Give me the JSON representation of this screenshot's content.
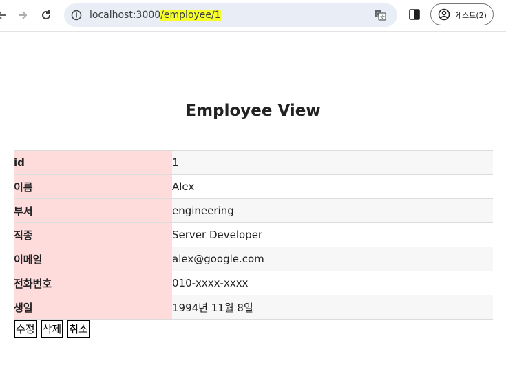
{
  "browser": {
    "url_host": "localhost:3000",
    "url_path": "/employee/1",
    "profile_label": "게스트(2)",
    "highlight_color": "#f6ff2a"
  },
  "page": {
    "title": "Employee View"
  },
  "employee": [
    {
      "label": "id",
      "value": "1"
    },
    {
      "label": "이름",
      "value": "Alex"
    },
    {
      "label": "부서",
      "value": "engineering"
    },
    {
      "label": "직종",
      "value": "Server Developer"
    },
    {
      "label": "이메일",
      "value": "alex@google.com"
    },
    {
      "label": "전화번호",
      "value": "010-xxxx-xxxx"
    },
    {
      "label": "생일",
      "value": "1994년 11월 8일"
    }
  ],
  "actions": {
    "edit_label": "수정",
    "delete_label": "삭제",
    "cancel_label": "취소"
  },
  "colors": {
    "label_cell_bg": "#ffdcdc",
    "omnibox_bg": "#e9edf6"
  }
}
